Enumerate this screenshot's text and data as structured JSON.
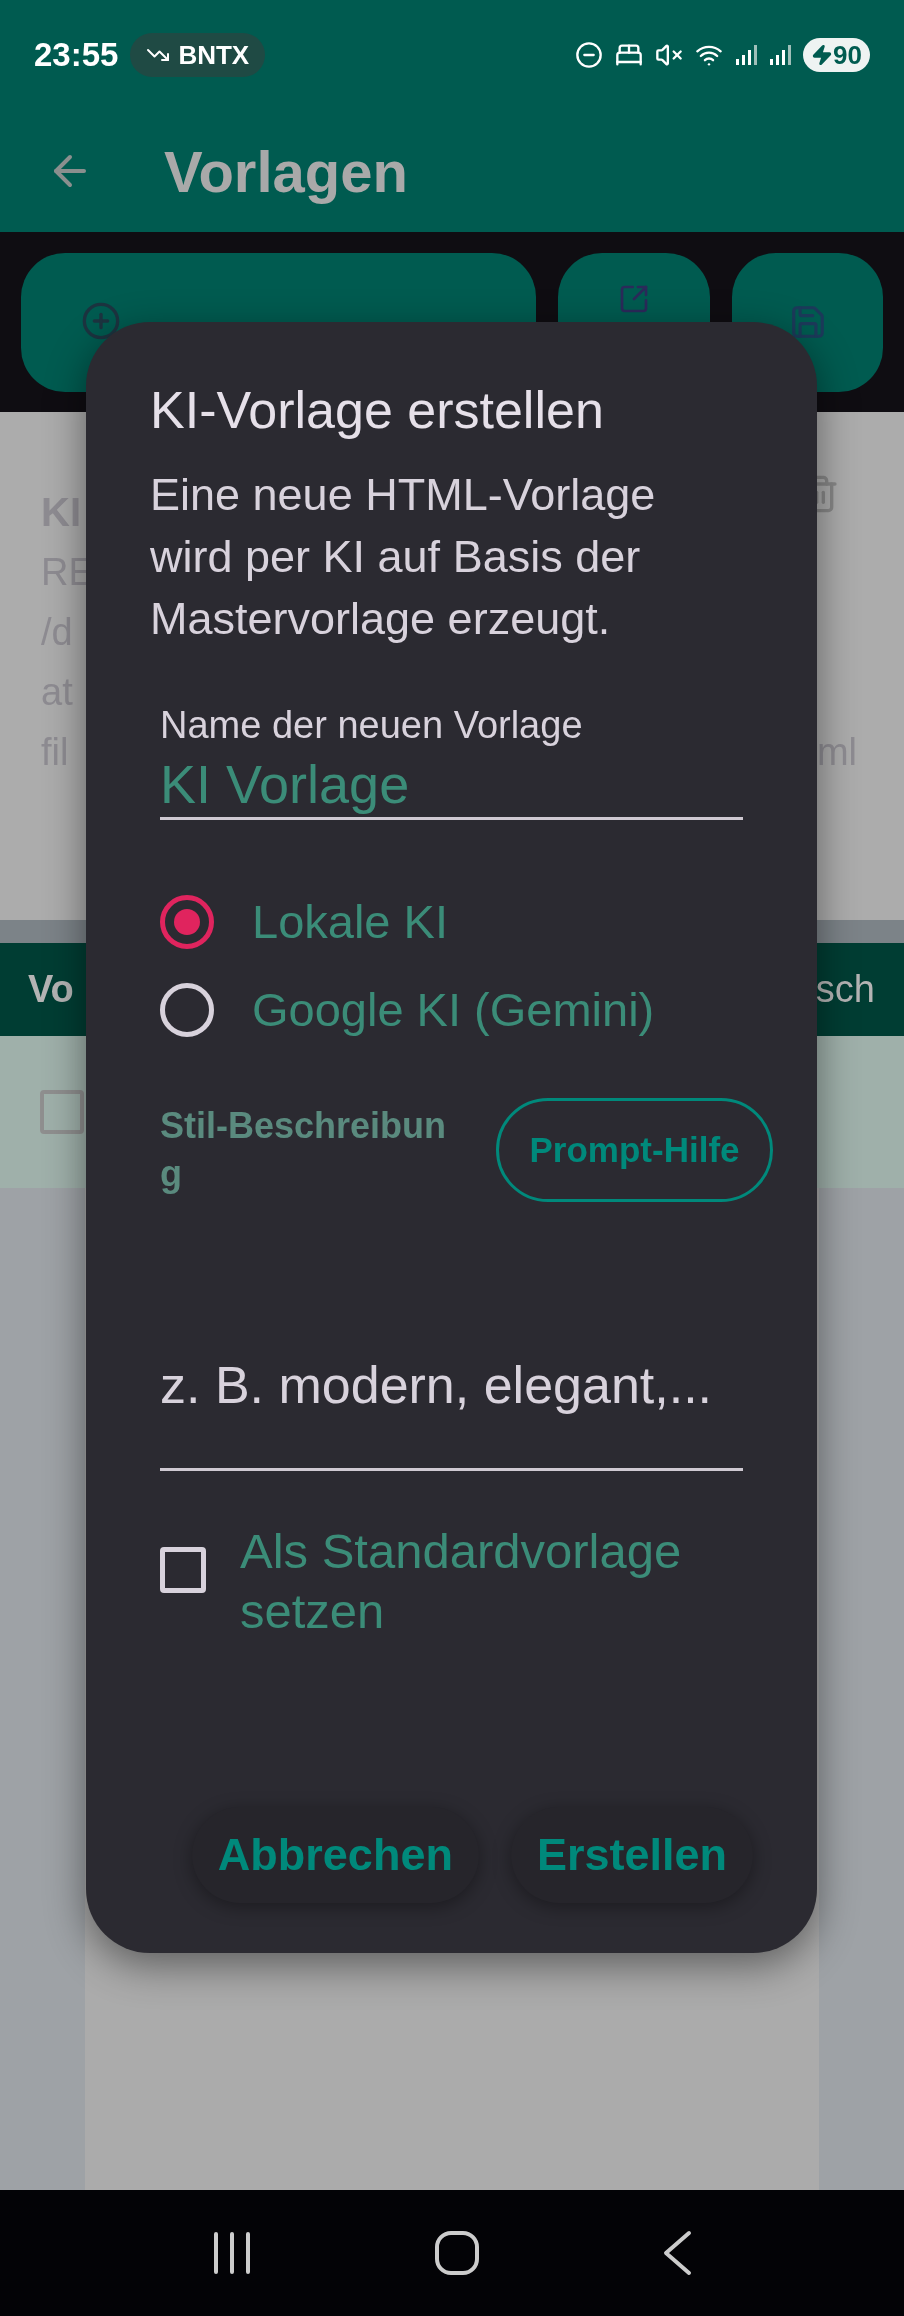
{
  "status_bar": {
    "time": "23:55",
    "ticker": "BNTX",
    "battery": "90"
  },
  "app_bar": {
    "title": "Vorlagen"
  },
  "background": {
    "card_title": "KI",
    "card_lines": [
      "RE",
      "/d",
      "at",
      "fil"
    ],
    "card_line_end": "ml",
    "list_header_left": "Vo",
    "list_header_right": "sch",
    "row_checked": false
  },
  "dialog": {
    "title": "KI-Vorlage erstellen",
    "message": "Eine neue HTML-Vorlage wird per KI auf Basis der Mastervorlage erzeugt.",
    "name_field": {
      "label": "Name der neuen Vorlage",
      "value": "KI Vorlage"
    },
    "ai_options": [
      {
        "label": "Lokale KI",
        "selected": true
      },
      {
        "label": "Google KI (Gemini)",
        "selected": false
      }
    ],
    "style_label": "Stil-Beschreibung",
    "prompt_help_button": "Prompt-Hilfe",
    "style_field": {
      "placeholder": "z. B. modern, elegant,..."
    },
    "default_checkbox": {
      "label": "Als Standardvorlage setzen",
      "checked": false
    },
    "buttons": [
      "Abbrechen",
      "Erstellen"
    ]
  }
}
